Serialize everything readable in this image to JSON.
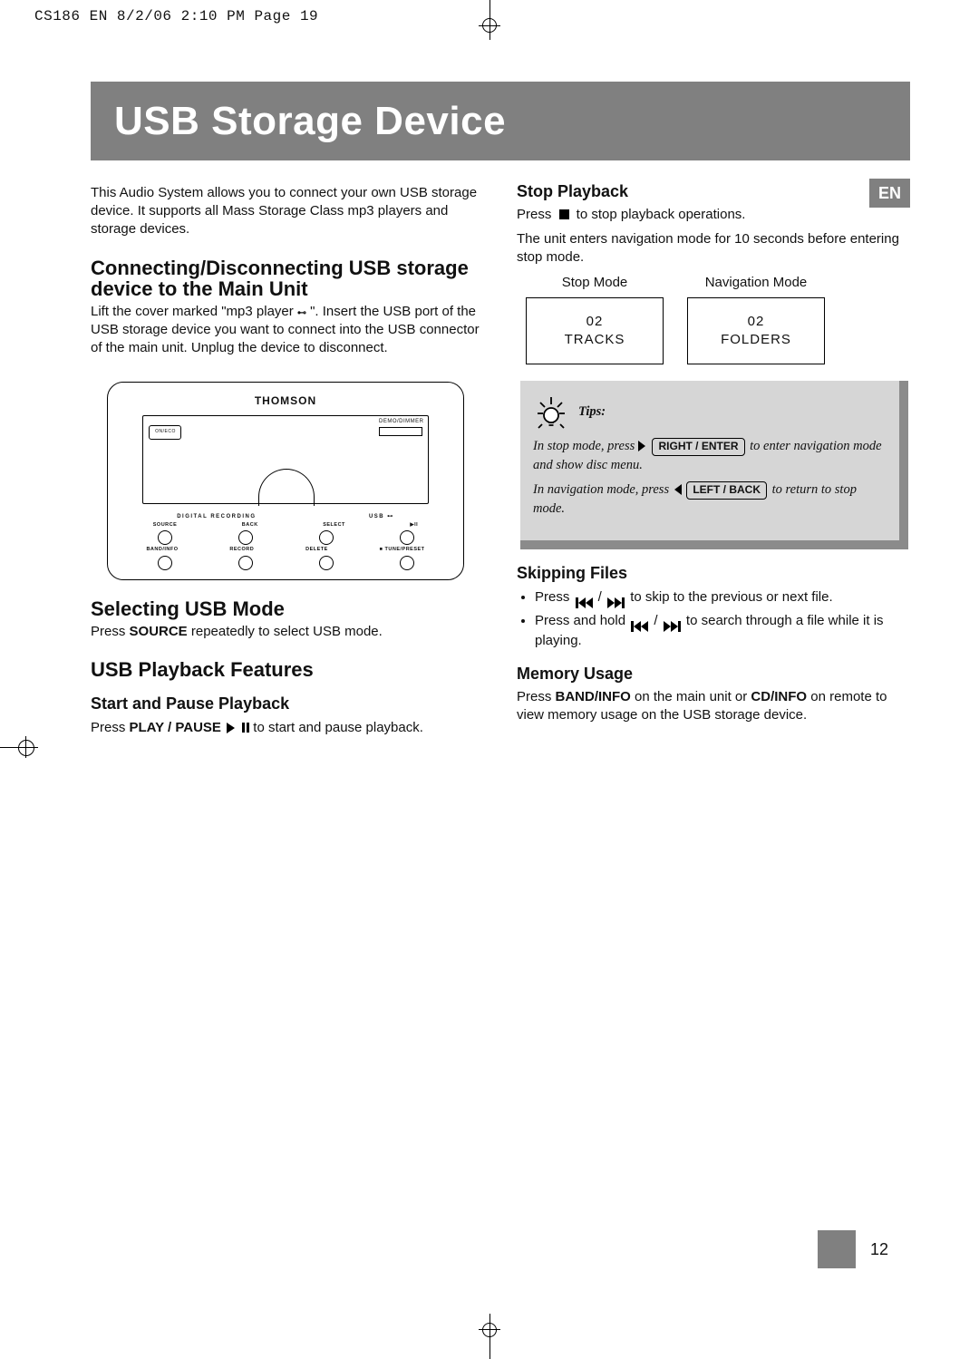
{
  "imposition": "CS186 EN  8/2/06  2:10 PM  Page 19",
  "title": "USB Storage Device",
  "lang_tab": "EN",
  "page_number": "12",
  "intro": "This Audio System allows you to connect your own USB storage device. It supports all Mass Storage Class mp3 players and storage devices.",
  "connect": {
    "heading": "Connecting/Disconnecting USB storage device to the Main Unit",
    "body_a": "Lift the cover marked \"mp3 player ",
    "body_b": " \". Insert the USB port of the USB storage device you want to connect into the USB connector of the main unit. Unplug the device to disconnect."
  },
  "figure": {
    "brand": "THOMSON",
    "demo": "DEMO/DIMMER",
    "oneco": "ON/ECO",
    "row1": [
      "DIGITAL RECORDING",
      "USB"
    ],
    "row2_labels": [
      "SOURCE",
      "BACK",
      "SELECT",
      "▶II"
    ],
    "row3_labels": [
      "BAND/INFO",
      "RECORD",
      "DELETE",
      "■ TUNE/PRESET"
    ]
  },
  "select_usb": {
    "heading": "Selecting USB Mode",
    "body_a": "Press ",
    "body_b": "SOURCE",
    "body_c": " repeatedly to select USB mode."
  },
  "features_heading": "USB Playback Features",
  "start_pause": {
    "heading": "Start and Pause Playback",
    "body_a": "Press ",
    "body_b": "PLAY / PAUSE",
    "body_c": " to start and pause playback."
  },
  "stop": {
    "heading": "Stop Playback",
    "body_a": "Press ",
    "body_b": " to stop playback operations.",
    "body_c": "The unit enters navigation mode for 10 seconds before entering stop mode."
  },
  "modes": {
    "stop_label": "Stop Mode",
    "nav_label": "Navigation Mode",
    "box1_top": "02",
    "box1_bottom": "TRACKS",
    "box2_top": "02",
    "box2_bottom": "FOLDERS"
  },
  "tips": {
    "heading": "Tips:",
    "p1a": "In stop mode, press ",
    "p1btn": "RIGHT / ENTER",
    "p1b": " to enter navigation mode and show disc menu.",
    "p2a": "In navigation mode, press ",
    "p2btn": "LEFT / BACK",
    "p2b": " to return to stop mode."
  },
  "skipping": {
    "heading": "Skipping Files",
    "li1a": "Press ",
    "li1b": " to skip to the previous or next file.",
    "li2a": "Press and hold ",
    "li2b": " to search through a file while it is playing."
  },
  "memory": {
    "heading": "Memory Usage",
    "body_a": "Press ",
    "body_b": "BAND/INFO",
    "body_c": " on the main unit or ",
    "body_d": "CD/INFO",
    "body_e": " on remote to view memory usage on the USB storage device."
  }
}
